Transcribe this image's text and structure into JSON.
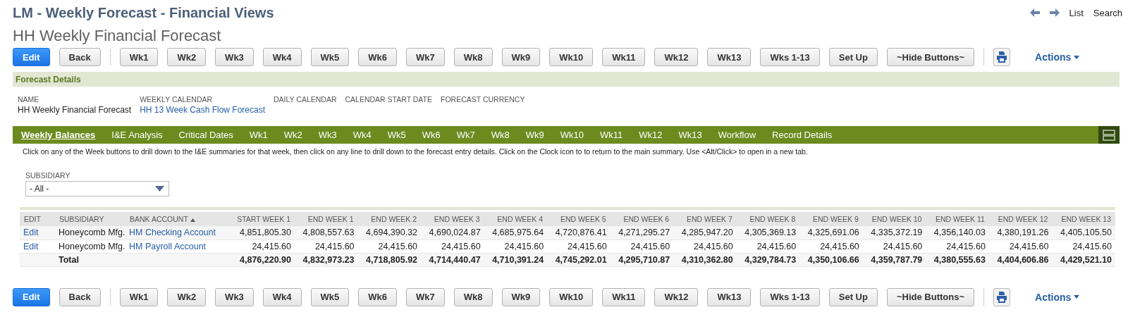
{
  "header": {
    "title": "LM - Weekly Forecast - Financial Views",
    "nav_links": [
      "List",
      "Search"
    ]
  },
  "record_title": "HH Weekly Financial Forecast",
  "toolbar_top": {
    "main_buttons": [
      {
        "label": "Edit",
        "kind": "primary"
      },
      {
        "label": "Back",
        "kind": "default"
      }
    ],
    "week_buttons": [
      "Wk1",
      "Wk2",
      "Wk3",
      "Wk4",
      "Wk5",
      "Wk6",
      "Wk7",
      "Wk8",
      "Wk9",
      "Wk10",
      "Wk11",
      "Wk12",
      "Wk13",
      "Wks 1-13",
      "Set Up",
      "~Hide Buttons~"
    ],
    "actions_label": "Actions"
  },
  "section": {
    "title": "Forecast Details",
    "fields": [
      {
        "label": "NAME",
        "value": "HH Weekly Financial Forecast",
        "kind": "text"
      },
      {
        "label": "WEEKLY CALENDAR",
        "value": "HH 13 Week Cash Flow Forecast",
        "kind": "link"
      },
      {
        "label": "DAILY CALENDAR"
      },
      {
        "label": "CALENDAR START DATE"
      },
      {
        "label": "FORECAST CURRENCY"
      }
    ]
  },
  "tabs": [
    {
      "label": "Weekly Balances",
      "selected": true
    },
    {
      "label": "I&E Analysis",
      "selected": false
    },
    {
      "label": "Critical Dates",
      "selected": false
    },
    {
      "label": "Wk1",
      "selected": false
    },
    {
      "label": "Wk2",
      "selected": false
    },
    {
      "label": "Wk3",
      "selected": false
    },
    {
      "label": "Wk4",
      "selected": false
    },
    {
      "label": "Wk5",
      "selected": false
    },
    {
      "label": "Wk6",
      "selected": false
    },
    {
      "label": "Wk7",
      "selected": false
    },
    {
      "label": "Wk8",
      "selected": false
    },
    {
      "label": "Wk9",
      "selected": false
    },
    {
      "label": "Wk10",
      "selected": false
    },
    {
      "label": "Wk11",
      "selected": false
    },
    {
      "label": "Wk12",
      "selected": false
    },
    {
      "label": "Wk13",
      "selected": false
    },
    {
      "label": "Workflow",
      "selected": false
    },
    {
      "label": "Record Details",
      "selected": false
    }
  ],
  "help_text": "Click on any of the Week buttons to drill down to the I&E summaries for that week, then click on any line to drill down to the forecast entry details. Click on the Clock icon to to return to the main summary. Use <Alt/Click> to open in a new tab.",
  "filter": {
    "label": "SUBSIDIARY",
    "value": "- All -"
  },
  "table": {
    "columns": [
      {
        "label": "EDIT",
        "sorted": false
      },
      {
        "label": "SUBSIDIARY",
        "sorted": false
      },
      {
        "label": "BANK ACCOUNT",
        "sorted": true
      },
      {
        "label": "START WEEK 1",
        "sorted": false
      },
      {
        "label": "END WEEK 1",
        "sorted": false
      },
      {
        "label": "END WEEK 2",
        "sorted": false
      },
      {
        "label": "END WEEK 3",
        "sorted": false
      },
      {
        "label": "END WEEK 4",
        "sorted": false
      },
      {
        "label": "END WEEK 5",
        "sorted": false
      },
      {
        "label": "END WEEK 6",
        "sorted": false
      },
      {
        "label": "END WEEK 7",
        "sorted": false
      },
      {
        "label": "END WEEK 8",
        "sorted": false
      },
      {
        "label": "END WEEK 9",
        "sorted": false
      },
      {
        "label": "END WEEK 10",
        "sorted": false
      },
      {
        "label": "END WEEK 11",
        "sorted": false
      },
      {
        "label": "END WEEK 12",
        "sorted": false
      },
      {
        "label": "END WEEK 13",
        "sorted": false
      }
    ],
    "rows": [
      {
        "edit": "Edit",
        "subsidiary": "Honeycomb Mfg.",
        "bank_account": "HM Checking Account",
        "values": [
          "4,851,805.30",
          "4,808,557.63",
          "4,694,390.32",
          "4,690,024.87",
          "4,685,975.64",
          "4,720,876.41",
          "4,271,295.27",
          "4,285,947.20",
          "4,305,369.13",
          "4,325,691.06",
          "4,335,372.19",
          "4,356,140.03",
          "4,380,191.26",
          "4,405,105.50"
        ]
      },
      {
        "edit": "Edit",
        "subsidiary": "Honeycomb Mfg.",
        "bank_account": "HM Payroll Account",
        "values": [
          "24,415.60",
          "24,415.60",
          "24,415.60",
          "24,415.60",
          "24,415.60",
          "24,415.60",
          "24,415.60",
          "24,415.60",
          "24,415.60",
          "24,415.60",
          "24,415.60",
          "24,415.60",
          "24,415.60",
          "24,415.60"
        ]
      }
    ],
    "total": {
      "label": "Total",
      "values": [
        "4,876,220.90",
        "4,832,973.23",
        "4,718,805.92",
        "4,714,440.47",
        "4,710,391.24",
        "4,745,292.01",
        "4,295,710.87",
        "4,310,362.80",
        "4,329,784.73",
        "4,350,106.66",
        "4,359,787.79",
        "4,380,555.63",
        "4,404,606.86",
        "4,429,521.10"
      ]
    }
  },
  "toolbar_bottom": {
    "main_buttons": [
      {
        "label": "Edit",
        "kind": "primary"
      },
      {
        "label": "Back",
        "kind": "default"
      }
    ],
    "week_buttons": [
      "Wk1",
      "Wk2",
      "Wk3",
      "Wk4",
      "Wk5",
      "Wk6",
      "Wk7",
      "Wk8",
      "Wk9",
      "Wk10",
      "Wk11",
      "Wk12",
      "Wk13",
      "Wks 1-13",
      "Set Up",
      "~Hide Buttons~"
    ],
    "actions_label": "Actions"
  }
}
